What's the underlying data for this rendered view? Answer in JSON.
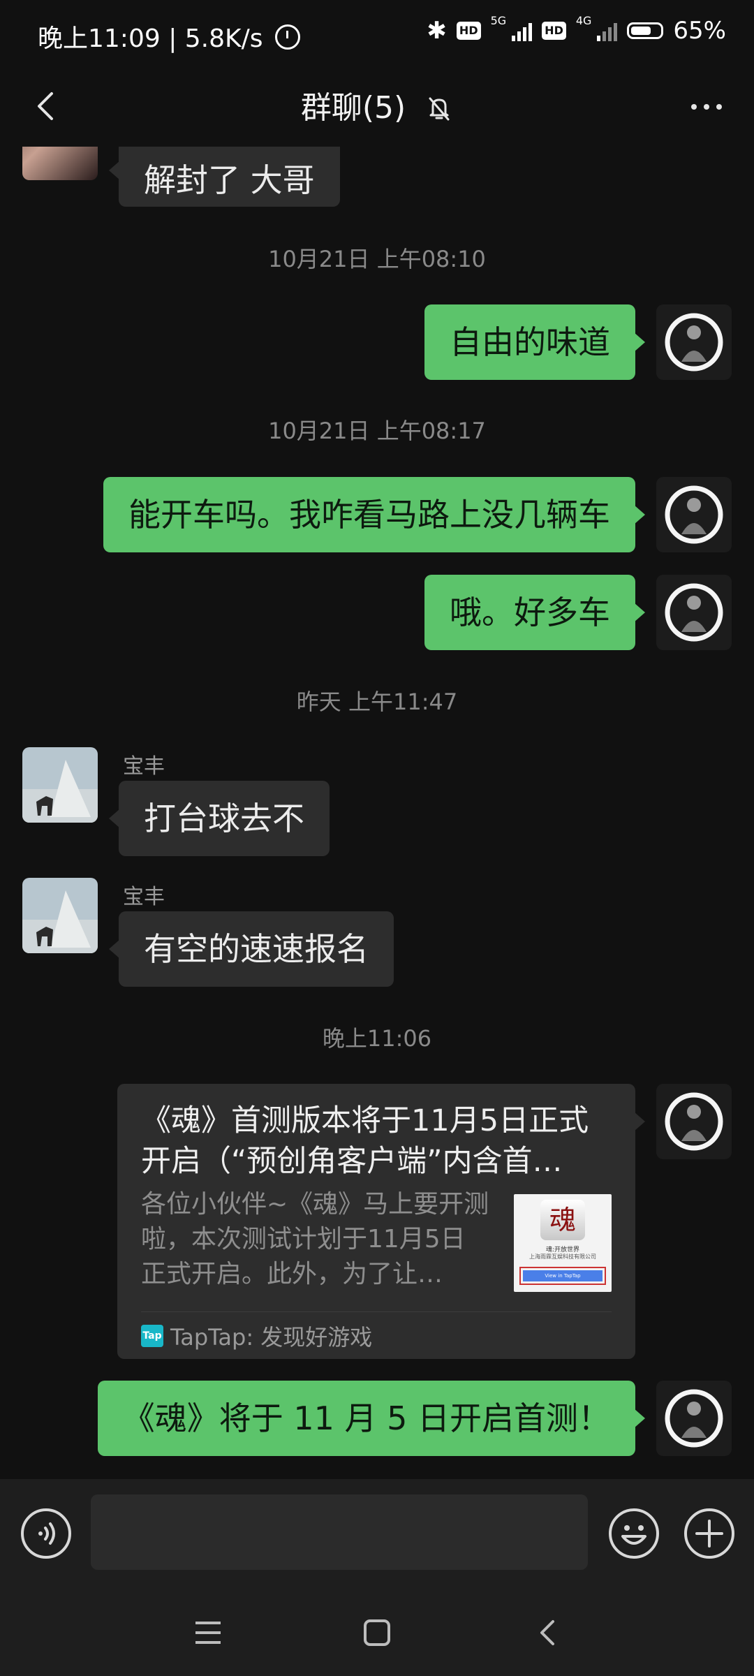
{
  "status_bar": {
    "time": "晚上11:09",
    "speed": "5.8K/s",
    "hd_badge": "HD",
    "net1": "5G",
    "net2": "4G",
    "battery": "65%"
  },
  "header": {
    "title": "群聊(5)"
  },
  "messages": {
    "m0": {
      "text": "解封了 大哥"
    },
    "t1": "10月21日 上午08:10",
    "m1": {
      "text": "自由的味道"
    },
    "t2": "10月21日 上午08:17",
    "m2": {
      "text": "能开车吗。我咋看马路上没几辆车"
    },
    "m3": {
      "text": "哦。好多车"
    },
    "t3": "昨天 上午11:47",
    "m4": {
      "sender": "宝丰",
      "text": "打台球去不"
    },
    "m5": {
      "sender": "宝丰",
      "text": "有空的速速报名"
    },
    "t4": "晚上11:06",
    "card": {
      "title": "《魂》首测版本将于11月5日正式开启（“预创角客户端”内含首…",
      "desc": "各位小伙伴~《魂》马上要开测啦，本次测试计划于11月5日正式开启。此外，为了让…",
      "thumb_logo": "魂",
      "thumb_line1": "魂:开放世界",
      "thumb_line2": "上海雨霖互娱科技有限公司",
      "thumb_button": "View in TapTap",
      "source_badge": "Tap",
      "source": "TapTap: 发现好游戏"
    },
    "m6": {
      "text": "《魂》将于 11 月 5 日开启首测！"
    }
  },
  "input": {
    "placeholder": ""
  },
  "colors": {
    "background": "#111111",
    "my_bubble": "#5cc46b",
    "other_bubble": "#2d2d2d",
    "input_bar": "#1e1e1e"
  },
  "icons": [
    "back-icon",
    "mute-bell-icon",
    "more-icon",
    "alarm-icon",
    "bluetooth-icon",
    "signal-icon",
    "battery-icon",
    "voice-icon",
    "emoji-icon",
    "plus-icon",
    "menu-icon",
    "home-icon",
    "back-nav-icon"
  ]
}
